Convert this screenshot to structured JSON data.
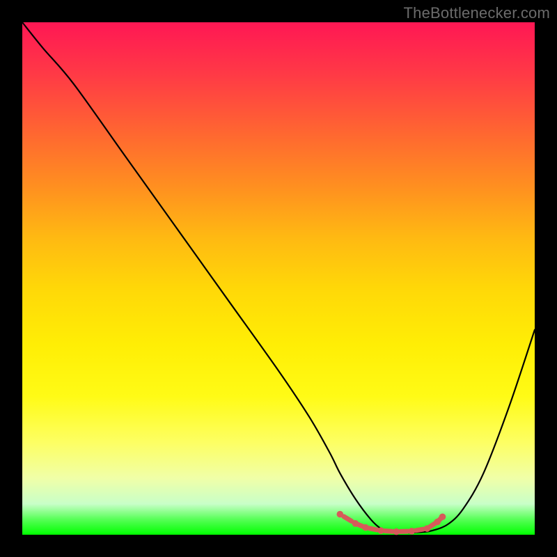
{
  "watermark": "TheBottlenecker.com",
  "chart_data": {
    "type": "line",
    "title": "",
    "xlabel": "",
    "ylabel": "",
    "xlim": [
      0,
      100
    ],
    "ylim": [
      0,
      100
    ],
    "series": [
      {
        "name": "bottleneck-curve",
        "x": [
          0,
          4,
          10,
          20,
          30,
          40,
          50,
          56,
          60,
          62,
          65,
          68,
          70,
          72,
          74,
          76,
          78,
          80,
          83,
          86,
          90,
          95,
          100
        ],
        "y": [
          100,
          95,
          88,
          74,
          60,
          46,
          32,
          23,
          16,
          12,
          7,
          3,
          1.2,
          0.6,
          0.4,
          0.4,
          0.5,
          0.8,
          2,
          5,
          12,
          25,
          40
        ]
      }
    ],
    "markers": {
      "name": "highlight-dots",
      "color": "#d65a5a",
      "points": [
        {
          "x": 62,
          "y": 4
        },
        {
          "x": 65,
          "y": 2.2
        },
        {
          "x": 67,
          "y": 1.4
        },
        {
          "x": 70,
          "y": 0.8
        },
        {
          "x": 73,
          "y": 0.6
        },
        {
          "x": 76,
          "y": 0.7
        },
        {
          "x": 79,
          "y": 1.2
        },
        {
          "x": 81,
          "y": 2.5
        },
        {
          "x": 82,
          "y": 3.5
        }
      ]
    },
    "background_gradient": {
      "top": "#ff1754",
      "bottom": "#00ff00"
    }
  }
}
